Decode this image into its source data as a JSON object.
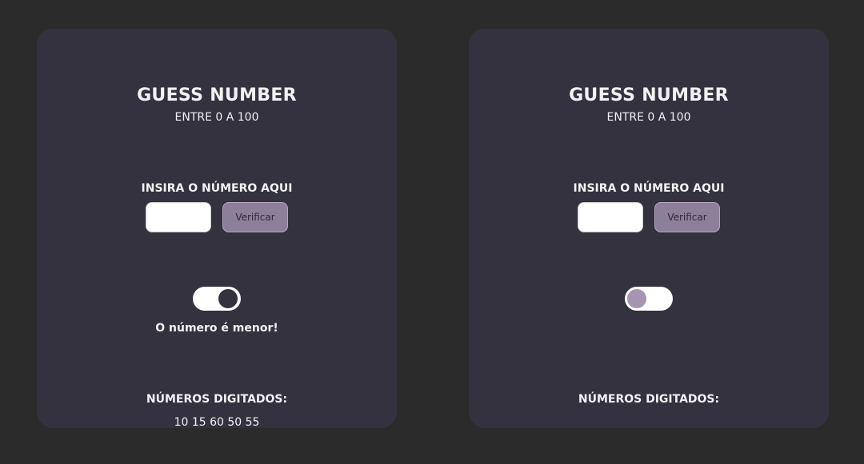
{
  "cards": [
    {
      "title": "GUESS NUMBER",
      "subtitle": "ENTRE 0 A 100",
      "input_label": "INSIRA O NÚMERO AQUI",
      "input_value": "",
      "verify_label": "Verificar",
      "toggle_state": "on",
      "hint": "O número é menor!",
      "history_label": "NÚMEROS DIGITADOS:",
      "history_values": "10 15 60 50 55"
    },
    {
      "title": "GUESS NUMBER",
      "subtitle": "ENTRE 0 A 100",
      "input_label": "INSIRA O NÚMERO AQUI",
      "input_value": "",
      "verify_label": "Verificar",
      "toggle_state": "off",
      "hint": "",
      "history_label": "NÚMEROS DIGITADOS:",
      "history_values": ""
    }
  ],
  "colors": {
    "page_background": "#2b2b2b",
    "card_background": "#34323f",
    "button_background": "#8b7f9a",
    "toggle_knob_off": "#a595b0"
  }
}
